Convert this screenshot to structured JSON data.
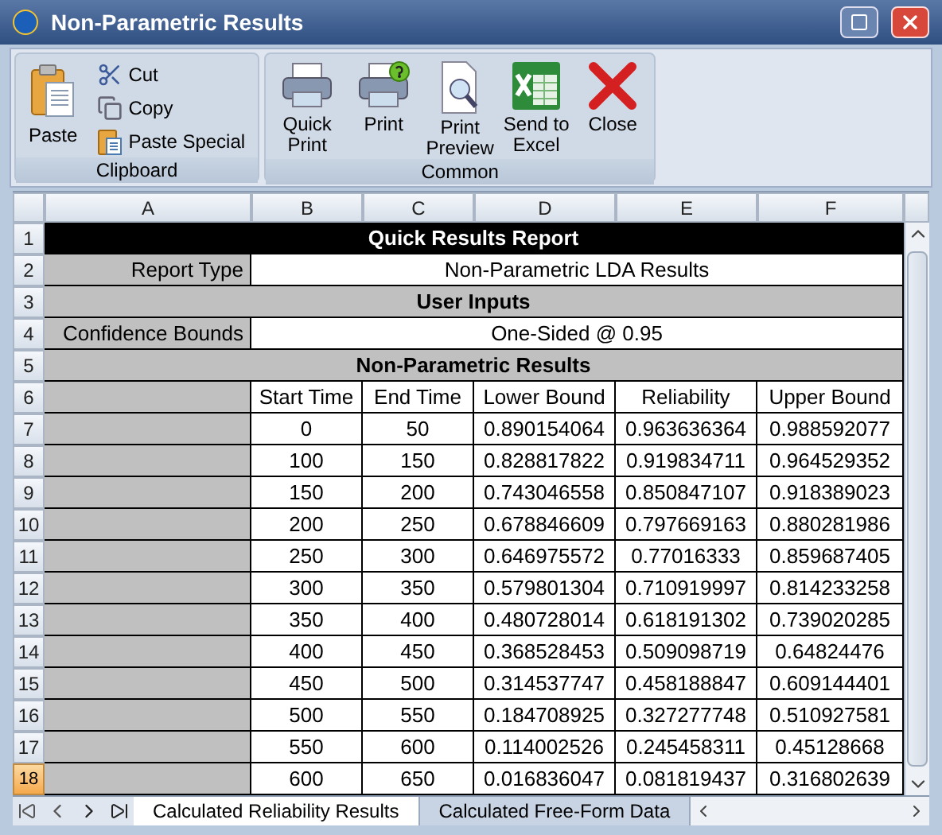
{
  "window": {
    "title": "Non-Parametric Results"
  },
  "ribbon": {
    "groups": [
      {
        "label": "Clipboard",
        "buttons": [
          {
            "label": "Paste",
            "kind": "paste"
          },
          {
            "label": "Cut",
            "kind": "cut"
          },
          {
            "label": "Copy",
            "kind": "copy"
          },
          {
            "label": "Paste Special",
            "kind": "paste_special"
          }
        ]
      },
      {
        "label": "Common",
        "buttons": [
          {
            "label": "Quick Print",
            "kind": "quick_print"
          },
          {
            "label": "Print",
            "kind": "print"
          },
          {
            "label": "Print Preview",
            "kind": "preview"
          },
          {
            "label": "Send to Excel",
            "kind": "excel"
          },
          {
            "label": "Close",
            "kind": "close"
          }
        ]
      }
    ]
  },
  "column_headers": [
    "A",
    "B",
    "C",
    "D",
    "E",
    "F"
  ],
  "grid": {
    "rows": [
      {
        "number": "1",
        "selected": false,
        "kind": "title",
        "cells": [
          "Quick Results Report"
        ]
      },
      {
        "number": "2",
        "selected": false,
        "kind": "label_value",
        "cells": [
          "Report Type",
          "Non-Parametric LDA Results"
        ]
      },
      {
        "number": "3",
        "selected": false,
        "kind": "section",
        "cells": [
          "User Inputs"
        ]
      },
      {
        "number": "4",
        "selected": false,
        "kind": "label_value",
        "cells": [
          "Confidence Bounds",
          "One-Sided @ 0.95"
        ]
      },
      {
        "number": "5",
        "selected": false,
        "kind": "section",
        "cells": [
          "Non-Parametric Results"
        ]
      },
      {
        "number": "6",
        "selected": false,
        "kind": "data",
        "cells": [
          "Start Time",
          "End Time",
          "Lower Bound",
          "Reliability",
          "Upper Bound"
        ]
      },
      {
        "number": "7",
        "selected": false,
        "kind": "data",
        "cells": [
          "0",
          "50",
          "0.890154064",
          "0.963636364",
          "0.988592077"
        ]
      },
      {
        "number": "8",
        "selected": false,
        "kind": "data",
        "cells": [
          "100",
          "150",
          "0.828817822",
          "0.919834711",
          "0.964529352"
        ]
      },
      {
        "number": "9",
        "selected": false,
        "kind": "data",
        "cells": [
          "150",
          "200",
          "0.743046558",
          "0.850847107",
          "0.918389023"
        ]
      },
      {
        "number": "10",
        "selected": false,
        "kind": "data",
        "cells": [
          "200",
          "250",
          "0.678846609",
          "0.797669163",
          "0.880281986"
        ]
      },
      {
        "number": "11",
        "selected": false,
        "kind": "data",
        "cells": [
          "250",
          "300",
          "0.646975572",
          "0.77016333",
          "0.859687405"
        ]
      },
      {
        "number": "12",
        "selected": false,
        "kind": "data",
        "cells": [
          "300",
          "350",
          "0.579801304",
          "0.710919997",
          "0.814233258"
        ]
      },
      {
        "number": "13",
        "selected": false,
        "kind": "data",
        "cells": [
          "350",
          "400",
          "0.480728014",
          "0.618191302",
          "0.739020285"
        ]
      },
      {
        "number": "14",
        "selected": false,
        "kind": "data",
        "cells": [
          "400",
          "450",
          "0.368528453",
          "0.509098719",
          "0.64824476"
        ]
      },
      {
        "number": "15",
        "selected": false,
        "kind": "data",
        "cells": [
          "450",
          "500",
          "0.314537747",
          "0.458188847",
          "0.609144401"
        ]
      },
      {
        "number": "16",
        "selected": false,
        "kind": "data",
        "cells": [
          "500",
          "550",
          "0.184708925",
          "0.327277748",
          "0.510927581"
        ]
      },
      {
        "number": "17",
        "selected": false,
        "kind": "data",
        "cells": [
          "550",
          "600",
          "0.114002526",
          "0.245458311",
          "0.45128668"
        ]
      },
      {
        "number": "18",
        "selected": true,
        "kind": "data",
        "cells": [
          "600",
          "650",
          "0.016836047",
          "0.081819437",
          "0.316802639"
        ]
      }
    ]
  },
  "sheet_tabs": [
    {
      "label": "Calculated Reliability Results",
      "selected": true
    },
    {
      "label": "Calculated Free-Form Data",
      "selected": false
    }
  ]
}
